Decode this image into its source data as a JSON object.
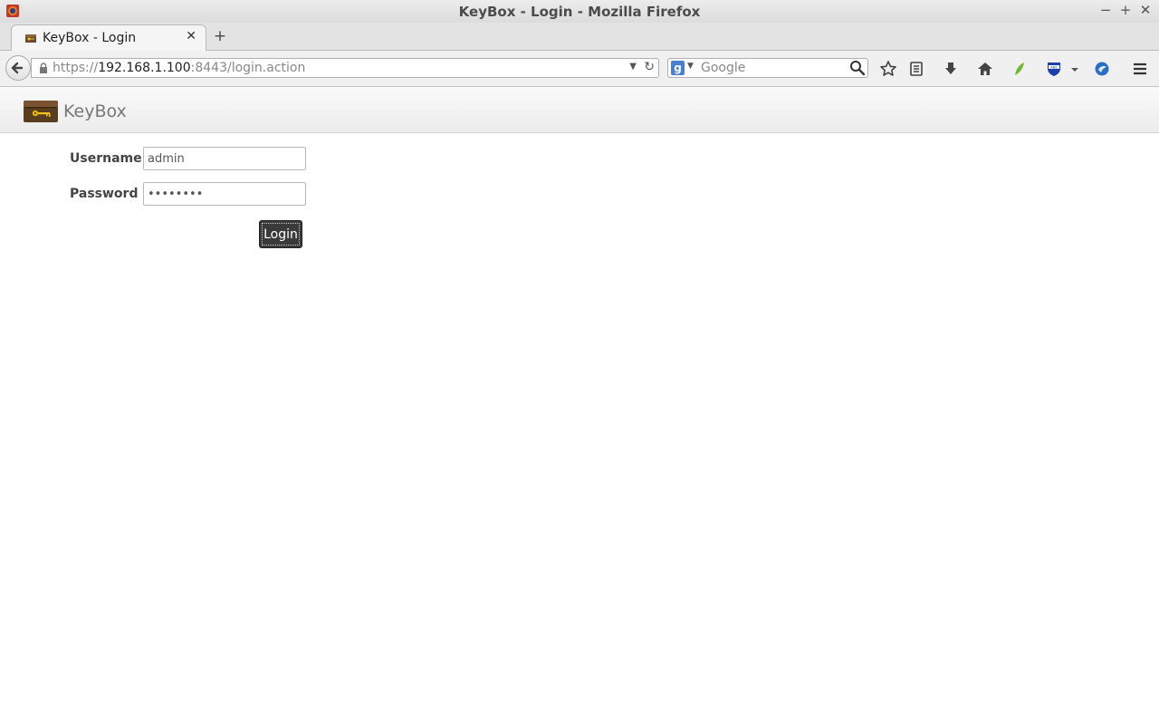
{
  "window": {
    "title": "KeyBox - Login - Mozilla Firefox",
    "controls": [
      "−",
      "+",
      "✕"
    ]
  },
  "tabs": [
    {
      "label": "KeyBox - Login",
      "close": "✕"
    }
  ],
  "newtab_label": "+",
  "address_bar": {
    "scheme": "https://",
    "host": "192.168.1.100",
    "rest": ":8443/login.action"
  },
  "search_bar": {
    "engine_letter": "g",
    "placeholder": "Google"
  },
  "toolbar_icons": [
    "bookmark-star-icon",
    "reading-list-icon",
    "downloads-icon",
    "home-icon",
    "leaf-addon-icon",
    "abe-shield-icon",
    "blue-addon-icon",
    "hamburger-menu-icon"
  ],
  "app": {
    "brand": "KeyBox"
  },
  "form": {
    "username_label": "Username",
    "username_value": "admin",
    "password_label": "Password",
    "password_value": "••••••••",
    "submit_label": "Login"
  },
  "colors": {
    "login_button_bg": "#3a3a3a",
    "brand_text": "#777777"
  }
}
